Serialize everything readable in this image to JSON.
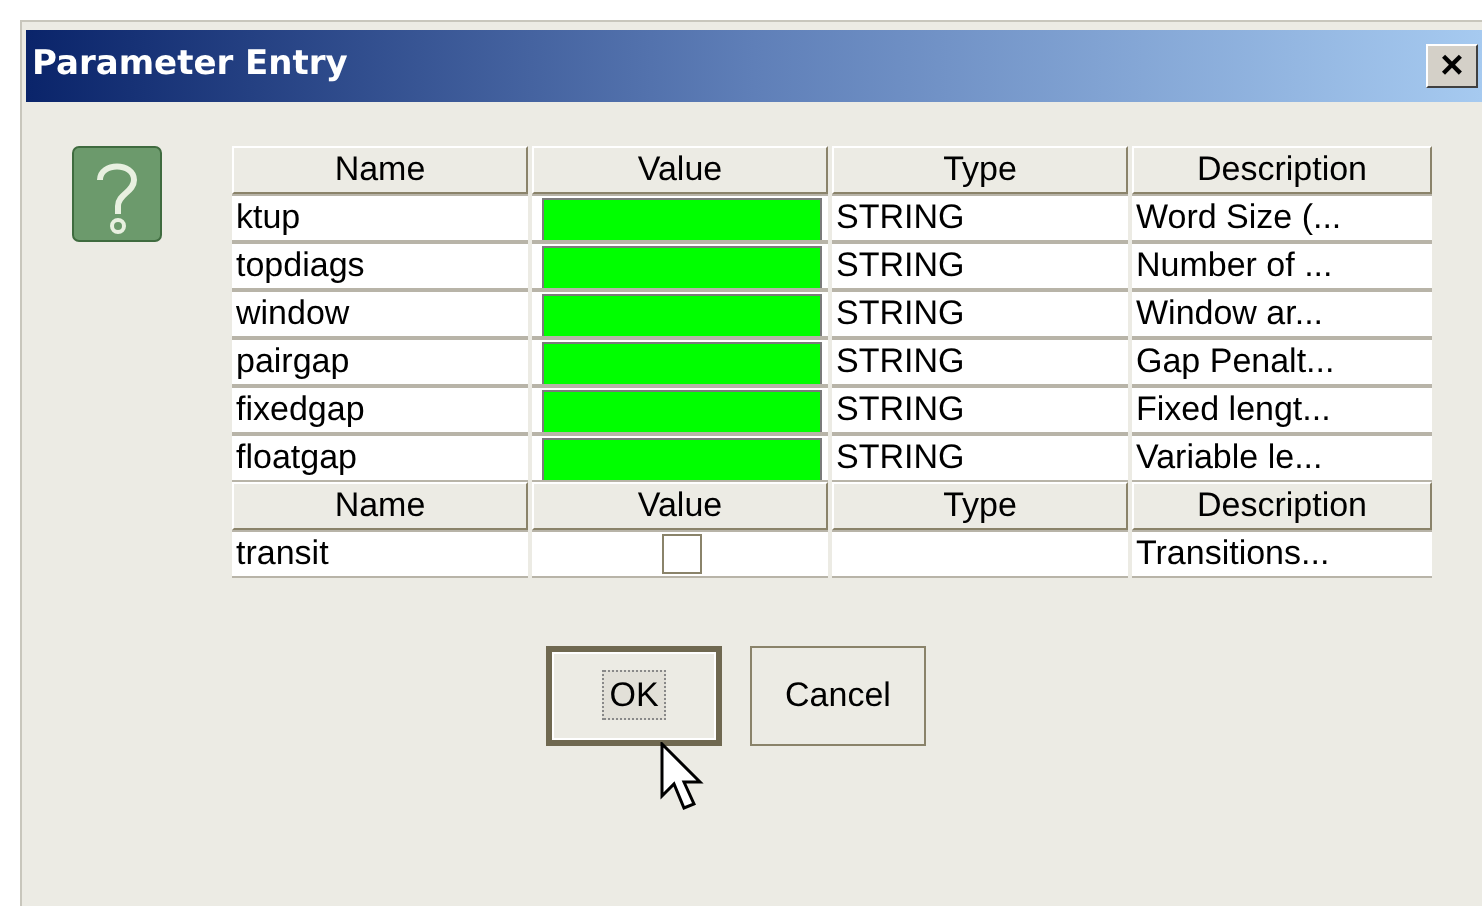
{
  "window": {
    "title": "Parameter Entry",
    "close_symbol": "×"
  },
  "tables": [
    {
      "columns": [
        "Name",
        "Value",
        "Type",
        "Description"
      ],
      "rows": [
        {
          "name": "ktup",
          "value": {
            "kind": "text-field"
          },
          "type": "STRING",
          "description": "Word Size (..."
        },
        {
          "name": "topdiags",
          "value": {
            "kind": "text-field"
          },
          "type": "STRING",
          "description": "Number of ..."
        },
        {
          "name": "window",
          "value": {
            "kind": "text-field"
          },
          "type": "STRING",
          "description": "Window ar..."
        },
        {
          "name": "pairgap",
          "value": {
            "kind": "text-field"
          },
          "type": "STRING",
          "description": "Gap Penalt..."
        },
        {
          "name": "fixedgap",
          "value": {
            "kind": "text-field"
          },
          "type": "STRING",
          "description": "Fixed lengt..."
        },
        {
          "name": "floatgap",
          "value": {
            "kind": "text-field"
          },
          "type": "STRING",
          "description": "Variable le..."
        }
      ]
    },
    {
      "columns": [
        "Name",
        "Value",
        "Type",
        "Description"
      ],
      "rows": [
        {
          "name": "transit",
          "value": {
            "kind": "checkbox",
            "checked": false
          },
          "description": "Transitions..."
        }
      ]
    }
  ],
  "buttons": [
    {
      "label": "OK",
      "focused": true
    },
    {
      "label": "Cancel",
      "focused": false
    }
  ]
}
